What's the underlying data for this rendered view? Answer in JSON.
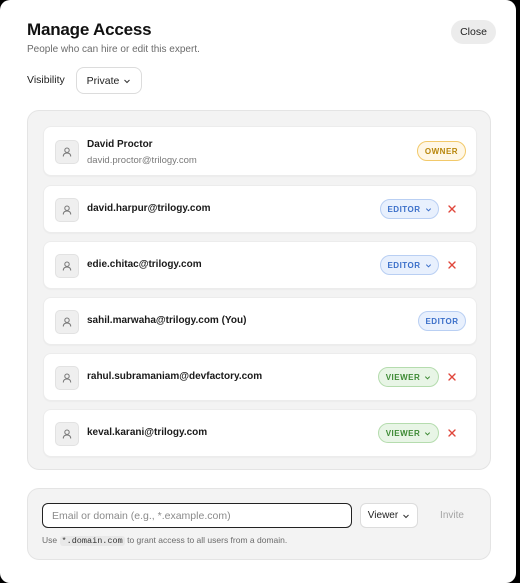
{
  "header": {
    "title": "Manage Access",
    "subtitle": "People who can hire or edit this expert.",
    "close_label": "Close"
  },
  "visibility": {
    "label": "Visibility",
    "value": "Private"
  },
  "members": [
    {
      "name": "David Proctor",
      "email": "david.proctor@trilogy.com",
      "role": "OWNER",
      "role_style": "owner",
      "has_dropdown": false,
      "removable": false
    },
    {
      "name": "david.harpur@trilogy.com",
      "role": "EDITOR",
      "role_style": "editor",
      "has_dropdown": true,
      "removable": true
    },
    {
      "name": "edie.chitac@trilogy.com",
      "role": "EDITOR",
      "role_style": "editor",
      "has_dropdown": true,
      "removable": true
    },
    {
      "name": "sahil.marwaha@trilogy.com (You)",
      "role": "EDITOR",
      "role_style": "editor",
      "has_dropdown": false,
      "removable": false
    },
    {
      "name": "rahul.subramaniam@devfactory.com",
      "role": "VIEWER",
      "role_style": "viewer",
      "has_dropdown": true,
      "removable": true
    },
    {
      "name": "keval.karani@trilogy.com",
      "role": "VIEWER",
      "role_style": "viewer",
      "has_dropdown": true,
      "removable": true
    }
  ],
  "invite": {
    "placeholder": "Email or domain (e.g., *.example.com)",
    "role_value": "Viewer",
    "button_label": "Invite",
    "hint_prefix": "Use",
    "hint_code": "*.domain.com",
    "hint_suffix": "to grant access to all users from a domain."
  },
  "icons": {
    "avatar": "user-icon",
    "remove": "x-icon",
    "dropdown": "chevron-down-icon"
  },
  "colors": {
    "remove": "#e0463b",
    "owner": "#b8860b",
    "editor": "#3b6fc9",
    "viewer": "#3d8a34"
  }
}
